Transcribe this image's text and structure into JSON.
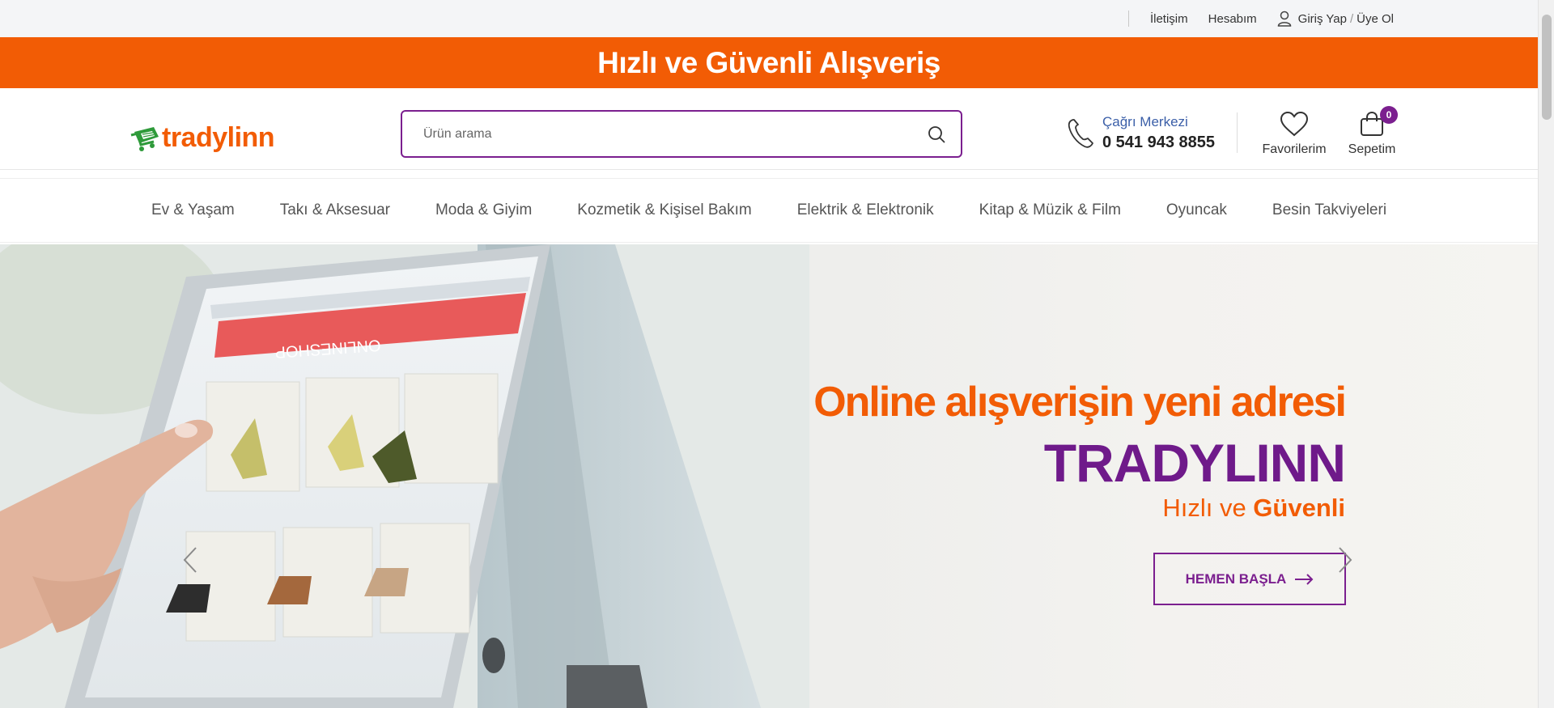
{
  "topbar": {
    "contact": "İletişim",
    "account": "Hesabım",
    "login": "Giriş Yap",
    "divider": "/",
    "register": "Üye Ol"
  },
  "promo": {
    "text": "Hızlı ve Güvenli Alışveriş"
  },
  "header": {
    "logo_text": "tradylinn",
    "search_placeholder": "Ürün arama",
    "call_center_label": "Çağrı Merkezi",
    "call_center_phone": "0 541 943 8855",
    "favorites_label": "Favorilerim",
    "cart_label": "Sepetim",
    "cart_count": "0"
  },
  "nav": {
    "items": [
      {
        "label": "Ev & Yaşam"
      },
      {
        "label": "Takı & Aksesuar"
      },
      {
        "label": "Moda & Giyim"
      },
      {
        "label": "Kozmetik & Kişisel Bakım"
      },
      {
        "label": "Elektrik & Elektronik"
      },
      {
        "label": "Kitap & Müzik & Film"
      },
      {
        "label": "Oyuncak"
      },
      {
        "label": "Besin Takviyeleri"
      }
    ]
  },
  "hero": {
    "headline": "Online alışverişin yeni adresi",
    "brand": "TRADYLINN",
    "tagline_part1": "Hızlı ve ",
    "tagline_part2": "Güvenli",
    "cta": "HEMEN BAŞLA",
    "screen_text": "ONLINESHOP"
  },
  "colors": {
    "accent_orange": "#f25c05",
    "accent_purple": "#7b1f8f",
    "logo_green": "#2e9a3a"
  },
  "icons": [
    "user-icon",
    "search-icon",
    "phone-icon",
    "heart-icon",
    "bag-icon",
    "arrow-right-icon",
    "chevron-left-icon",
    "chevron-right-icon"
  ]
}
